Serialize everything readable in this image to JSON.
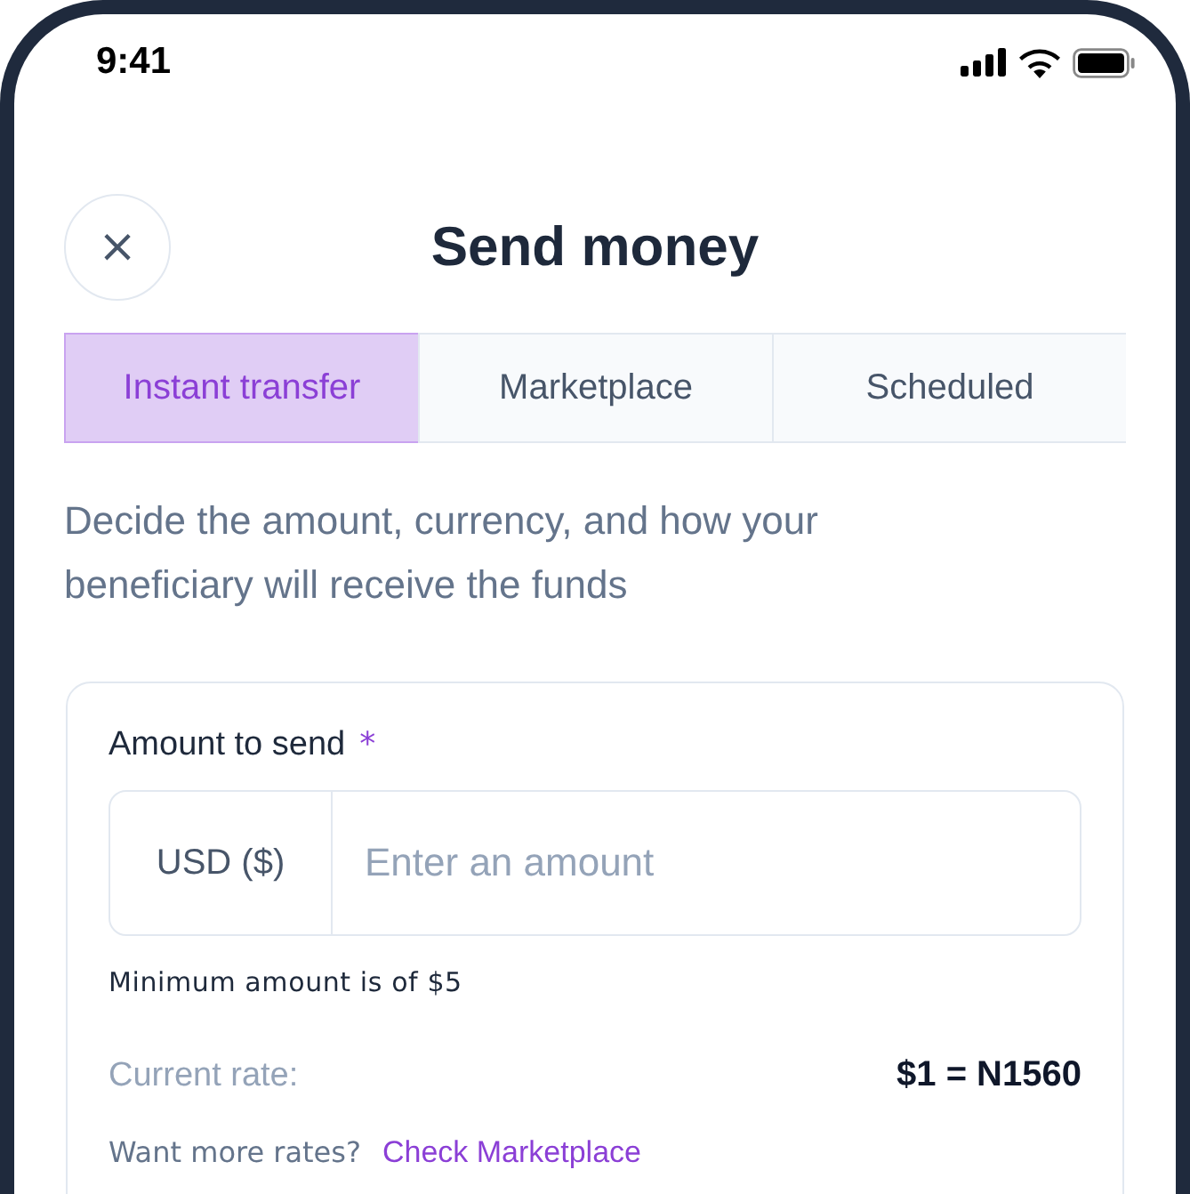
{
  "status_bar": {
    "time": "9:41"
  },
  "header": {
    "close": "×",
    "title": "Send money"
  },
  "tabs": [
    {
      "label": "Instant transfer",
      "selected": true
    },
    {
      "label": "Marketplace",
      "selected": false
    },
    {
      "label": "Scheduled",
      "selected": false
    }
  ],
  "description": "Decide the amount, currency, and how your beneficiary will receive the funds",
  "form": {
    "label": "Amount to send",
    "required_mark": "*",
    "currency": "USD ($)",
    "placeholder": "Enter an amount",
    "hint": "Minimum amount is of $5",
    "rate_label": "Current rate:",
    "rate_value": "$1 = N1560",
    "more_rates": "Want more rates?",
    "link": "Check Marketplace"
  }
}
